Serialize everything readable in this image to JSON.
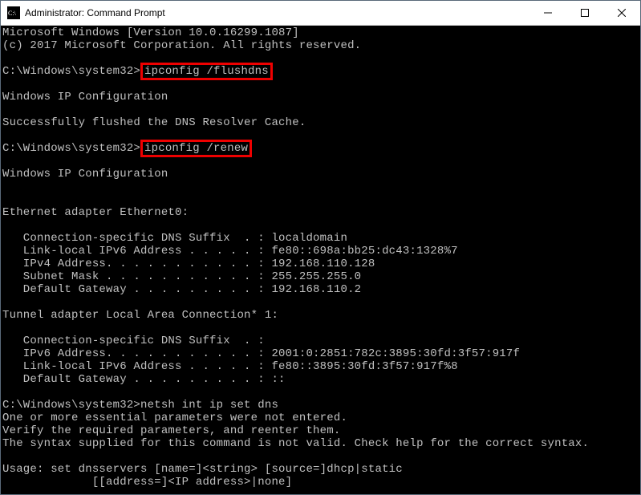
{
  "window": {
    "title": "Administrator: Command Prompt"
  },
  "terminal": {
    "header1": "Microsoft Windows [Version 10.0.16299.1087]",
    "header2": "(c) 2017 Microsoft Corporation. All rights reserved.",
    "prompt1_prefix": "C:\\Windows\\system32>",
    "cmd1": "ipconfig /flushdns",
    "ipconf_header": "Windows IP Configuration",
    "flush_result": "Successfully flushed the DNS Resolver Cache.",
    "prompt2_prefix": "C:\\Windows\\system32>",
    "cmd2": "ipconfig /renew",
    "ipconf_header2": "Windows IP Configuration",
    "eth_header": "Ethernet adapter Ethernet0:",
    "eth_line1": "   Connection-specific DNS Suffix  . : localdomain",
    "eth_line2": "   Link-local IPv6 Address . . . . . : fe80::698a:bb25:dc43:1328%7",
    "eth_line3": "   IPv4 Address. . . . . . . . . . . : 192.168.110.128",
    "eth_line4": "   Subnet Mask . . . . . . . . . . . : 255.255.255.0",
    "eth_line5": "   Default Gateway . . . . . . . . . : 192.168.110.2",
    "tun_header": "Tunnel adapter Local Area Connection* 1:",
    "tun_line1": "   Connection-specific DNS Suffix  . :",
    "tun_line2": "   IPv6 Address. . . . . . . . . . . : 2001:0:2851:782c:3895:30fd:3f57:917f",
    "tun_line3": "   Link-local IPv6 Address . . . . . : fe80::3895:30fd:3f57:917f%8",
    "tun_line4": "   Default Gateway . . . . . . . . . : ::",
    "prompt3": "C:\\Windows\\system32>netsh int ip set dns",
    "err1": "One or more essential parameters were not entered.",
    "err2": "Verify the required parameters, and reenter them.",
    "err3": "The syntax supplied for this command is not valid. Check help for the correct syntax.",
    "usage1": "Usage: set dnsservers [name=]<string> [source=]dhcp|static",
    "usage2": "             [[address=]<IP address>|none]"
  }
}
